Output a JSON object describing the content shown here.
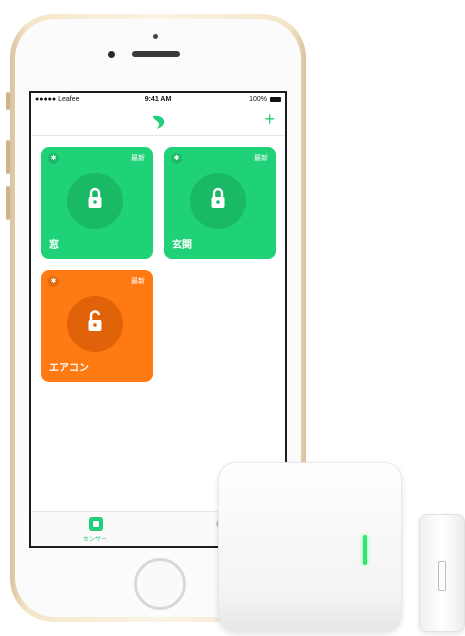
{
  "status_bar": {
    "carrier": "●●●●● Leafee",
    "time": "9:41 AM",
    "battery": "100%"
  },
  "nav": {
    "logo_icon": "leafee-leaf-icon",
    "add_label": "+"
  },
  "sensors": [
    {
      "name": "窓",
      "tag": "最新",
      "state": "locked",
      "color": "#1fd278",
      "ring": "#19b966"
    },
    {
      "name": "玄関",
      "tag": "最新",
      "state": "locked",
      "color": "#1fd278",
      "ring": "#19b966"
    },
    {
      "name": "エアコン",
      "tag": "最新",
      "state": "unlocked",
      "color": "#ff7a13",
      "ring": "#e0630a"
    }
  ],
  "tabbar": {
    "sensor_label": "センサー",
    "settings_label": "設"
  },
  "colors": {
    "accent": "#1fcf7a",
    "locked": "#1fd278",
    "unlocked": "#ff7a13"
  }
}
